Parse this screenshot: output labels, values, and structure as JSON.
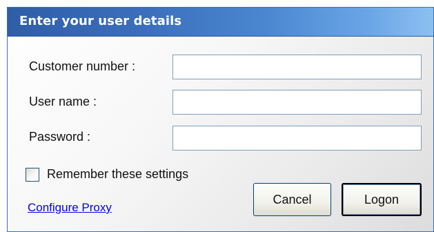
{
  "dialog": {
    "title": "Enter your user details",
    "fields": {
      "customer_number": {
        "label": "Customer number :",
        "value": "",
        "placeholder": ""
      },
      "user_name": {
        "label": "User name :",
        "value": "",
        "placeholder": ""
      },
      "password": {
        "label": "Password :",
        "value": "",
        "placeholder": ""
      }
    },
    "remember": {
      "label": "Remember these settings",
      "checked": false
    },
    "configure_proxy_link": "Configure Proxy",
    "buttons": {
      "cancel": "Cancel",
      "logon": "Logon"
    }
  },
  "colors": {
    "titlebar_start": "#2f5ea6",
    "titlebar_end": "#8cc0f0",
    "link": "#0000ee",
    "field_border": "#7f9db9"
  }
}
